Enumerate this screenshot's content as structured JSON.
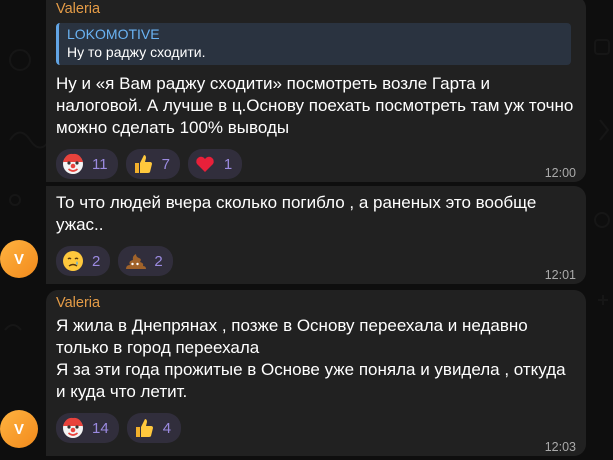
{
  "messages": [
    {
      "sender": "Valeria",
      "reply": {
        "name": "LOKOMOTIVE",
        "text": "Ну то раджу сходити."
      },
      "text": "Ну и «я Вам раджу сходити» посмотреть возле Гарта и налоговой. А лучше в ц.Основу поехать посмотреть там уж точно можно сделать 100% выводы",
      "reactions": [
        {
          "icon": "clown-face-icon",
          "count": "11"
        },
        {
          "icon": "thumbs-up-icon",
          "count": "7"
        },
        {
          "icon": "red-heart-icon",
          "count": "1"
        }
      ],
      "time": "12:00"
    },
    {
      "text": "То что людей вчера сколько погибло , а раненых это вообще ужас..",
      "reactions": [
        {
          "icon": "crying-face-icon",
          "count": "2"
        },
        {
          "icon": "pile-of-poo-icon",
          "count": "2"
        }
      ],
      "time": "12:01",
      "avatar": "V"
    },
    {
      "sender": "Valeria",
      "text": "Я жила в Днепрянах , позже в Основу переехала и недавно только в город переехала\nЯ за эти года прожитые в Основе уже поняла и увидела , откуда и куда что летит.",
      "reactions": [
        {
          "icon": "clown-face-icon",
          "count": "14"
        },
        {
          "icon": "thumbs-up-icon",
          "count": "4"
        }
      ],
      "time": "12:03",
      "avatar": "V"
    }
  ],
  "colors": {
    "bubble": "#212121",
    "sender": "#e59c47",
    "reply_accent": "#62a5e5",
    "reaction_bg": "#312e3c",
    "reaction_count": "#9b8ae0",
    "avatar": "#f59b2c"
  }
}
